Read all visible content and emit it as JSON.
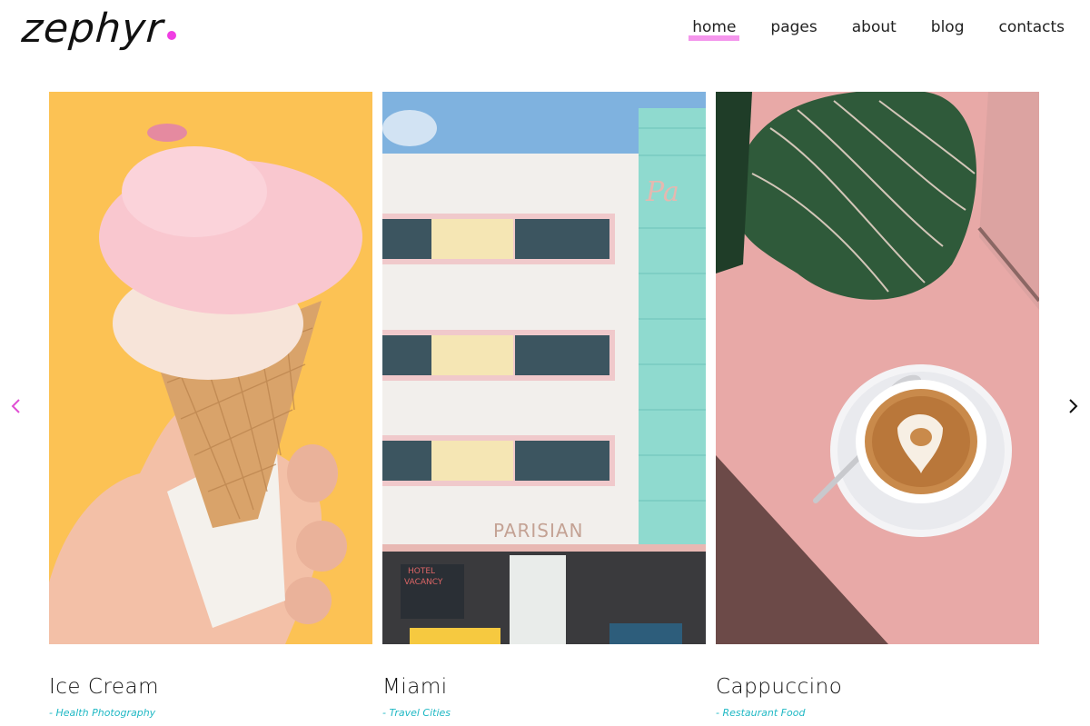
{
  "brand": {
    "logo_text": "zephyr",
    "accent_color": "#f03ee3"
  },
  "nav": {
    "items": [
      {
        "label": "home",
        "active": true
      },
      {
        "label": "pages",
        "active": false
      },
      {
        "label": "about",
        "active": false
      },
      {
        "label": "blog",
        "active": false
      },
      {
        "label": "contacts",
        "active": false
      }
    ]
  },
  "slider": {
    "prev_icon": "chevron-left-icon",
    "next_icon": "chevron-right-icon",
    "cards": [
      {
        "title": "Ice Cream",
        "subtitle": "- Health Photography",
        "image": "ice-cream-cone-photo"
      },
      {
        "title": "Miami",
        "subtitle": "- Travel Cities",
        "image": "parisian-hotel-building-photo"
      },
      {
        "title": "Cappuccino",
        "subtitle": "- Restaurant Food",
        "image": "cappuccino-cup-photo"
      }
    ]
  },
  "colors": {
    "subtitle": "#1fb8c4",
    "nav_highlight": "#f38bea"
  }
}
